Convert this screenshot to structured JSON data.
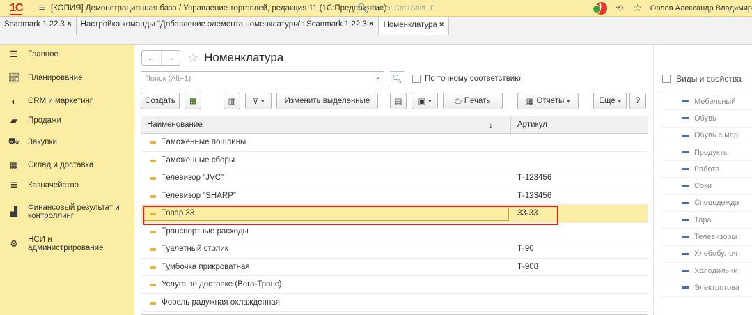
{
  "titlebar": {
    "logo": "1С",
    "title": "[КОПИЯ] Демонстрационная база / Управление торговлей, редакция 11 (1С:Предприятие)",
    "search_placeholder": "Поиск Ctrl+Shift+F",
    "notification_count": "1",
    "user": "Орлов Александр Владимир"
  },
  "tabs": [
    {
      "label": "Scanmark 1.22.3"
    },
    {
      "label": "Настройка команды \"Добавление элемента номенклатуры\": Scanmark 1.22.3"
    },
    {
      "label": "Номенклатура"
    }
  ],
  "sidebar": {
    "items": [
      {
        "label": "Главное",
        "icon": "menu-icon"
      },
      {
        "label": "Планирование",
        "icon": "planning-icon"
      },
      {
        "label": "CRM и маркетинг",
        "icon": "crm-icon"
      },
      {
        "label": "Продажи",
        "icon": "sales-bag-icon"
      },
      {
        "label": "Закупки",
        "icon": "cart-icon"
      },
      {
        "label": "Склад и доставка",
        "icon": "warehouse-icon"
      },
      {
        "label": "Казначейство",
        "icon": "treasury-icon"
      },
      {
        "label": "Финансовый результат и контроллинг",
        "icon": "bar-chart-icon"
      },
      {
        "label": "НСИ и администрирование",
        "icon": "gear-icon"
      }
    ]
  },
  "page": {
    "title": "Номенклатура",
    "search_placeholder": "Поиск (Alt+1)",
    "exact_match_label": "По точному соответствию"
  },
  "toolbar": {
    "create": "Создать",
    "change_selected": "Изменить выделенные",
    "print": "Печать",
    "reports": "Отчеты",
    "more": "Еще",
    "help": "?"
  },
  "grid": {
    "columns": {
      "name": "Наименование",
      "sort_arrow": "↓",
      "article": "Артикул"
    },
    "rows": [
      {
        "name": "Таможенные пошлины",
        "article": ""
      },
      {
        "name": "Таможенные сборы",
        "article": ""
      },
      {
        "name": "Телевизор \"JVC\"",
        "article": "Т-123456"
      },
      {
        "name": "Телевизор \"SHARP\"",
        "article": "Т-123456"
      },
      {
        "name": "Товар 33",
        "article": "33-33"
      },
      {
        "name": "Транспортные расходы",
        "article": ""
      },
      {
        "name": "Туалетный столик",
        "article": "Т-90"
      },
      {
        "name": "Тумбочка прикроватная",
        "article": "Т-908"
      },
      {
        "name": "Услуга по доставке (Вега-Транс)",
        "article": ""
      },
      {
        "name": "Форель радужная охлажденная",
        "article": ""
      }
    ]
  },
  "right_panel": {
    "header": "Виды и свойства",
    "items": [
      "Мебельный",
      "Обувь",
      "Обувь с мар",
      "Продукты",
      "Работа",
      "Соки",
      "Спецодежда",
      "Тара",
      "Телевизоры",
      "Хлебобулоч",
      "Холодильни",
      "Электротова"
    ]
  },
  "colors": {
    "accent_yellow": "#fbeda3",
    "highlight_red": "#e02020",
    "logo_red": "#d9261c"
  }
}
